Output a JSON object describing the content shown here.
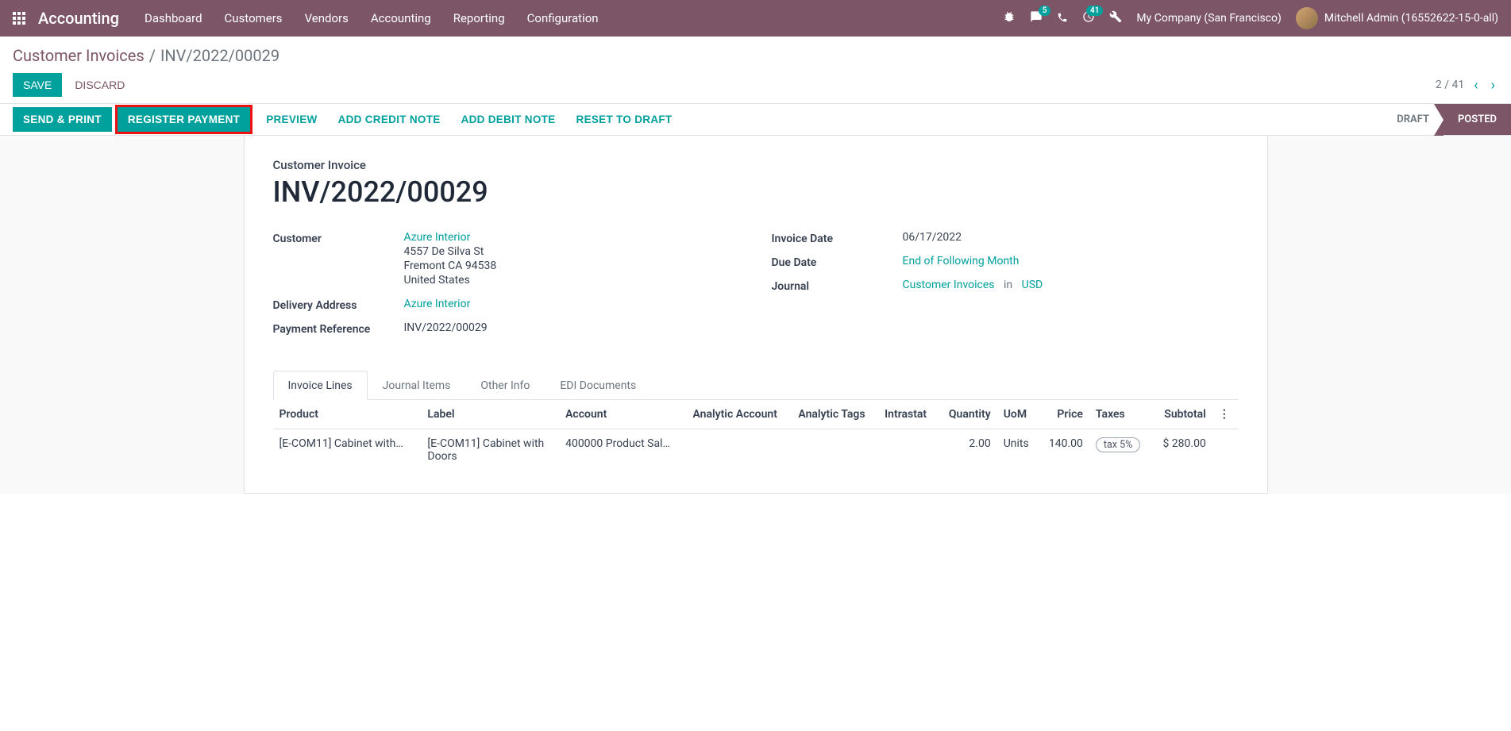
{
  "navbar": {
    "app_name": "Accounting",
    "menu": [
      "Dashboard",
      "Customers",
      "Vendors",
      "Accounting",
      "Reporting",
      "Configuration"
    ],
    "badge_messages": "5",
    "badge_activities": "41",
    "company": "My Company (San Francisco)",
    "user": "Mitchell Admin (16552622-15-0-all)"
  },
  "breadcrumb": {
    "parent": "Customer Invoices",
    "current": "INV/2022/00029"
  },
  "control": {
    "save": "SAVE",
    "discard": "DISCARD",
    "pager_text": "2 / 41"
  },
  "statusbar": {
    "send_print": "SEND & PRINT",
    "register_payment": "REGISTER PAYMENT",
    "preview": "PREVIEW",
    "add_credit_note": "ADD CREDIT NOTE",
    "add_debit_note": "ADD DEBIT NOTE",
    "reset_draft": "RESET TO DRAFT",
    "draft": "DRAFT",
    "posted": "POSTED"
  },
  "form": {
    "type_label": "Customer Invoice",
    "name": "INV/2022/00029",
    "left": {
      "customer_label": "Customer",
      "customer_name": "Azure Interior",
      "addr1": "4557 De Silva St",
      "addr2": "Fremont CA 94538",
      "addr3": "United States",
      "delivery_label": "Delivery Address",
      "delivery_value": "Azure Interior",
      "payref_label": "Payment Reference",
      "payref_value": "INV/2022/00029"
    },
    "right": {
      "invdate_label": "Invoice Date",
      "invdate_value": "06/17/2022",
      "duedate_label": "Due Date",
      "duedate_value": "End of Following Month",
      "journal_label": "Journal",
      "journal_value": "Customer Invoices",
      "journal_in": "in",
      "journal_currency": "USD"
    }
  },
  "tabs": [
    "Invoice Lines",
    "Journal Items",
    "Other Info",
    "EDI Documents"
  ],
  "table": {
    "headers": {
      "product": "Product",
      "label": "Label",
      "account": "Account",
      "analytic_account": "Analytic Account",
      "analytic_tags": "Analytic Tags",
      "intrastat": "Intrastat",
      "quantity": "Quantity",
      "uom": "UoM",
      "price": "Price",
      "taxes": "Taxes",
      "subtotal": "Subtotal"
    },
    "row0": {
      "product": "[E-COM11] Cabinet with…",
      "label": "[E-COM11] Cabinet with Doors",
      "account": "400000 Product Sal…",
      "quantity": "2.00",
      "uom": "Units",
      "price": "140.00",
      "tax": "tax 5%",
      "subtotal": "$ 280.00"
    }
  }
}
